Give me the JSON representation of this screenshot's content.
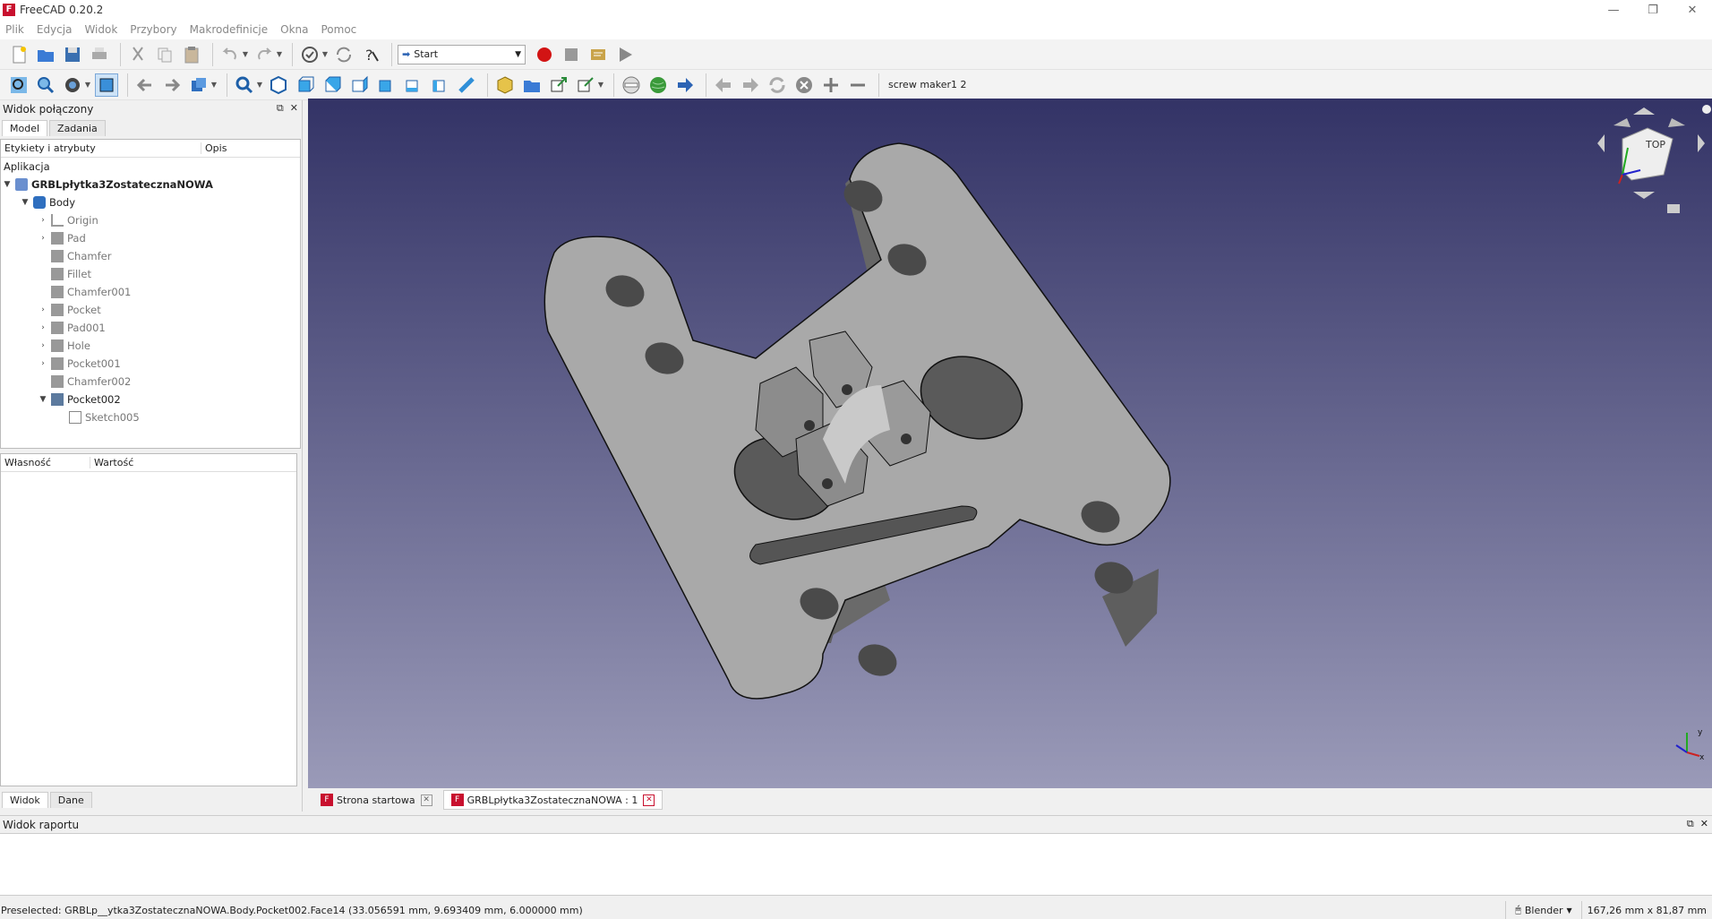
{
  "app": {
    "title": "FreeCAD 0.20.2"
  },
  "menu": [
    "Plik",
    "Edycja",
    "Widok",
    "Przybory",
    "Makrodefinicje",
    "Okna",
    "Pomoc"
  ],
  "toolbar": {
    "workbench": "Start",
    "macro_label": "screw maker1 2"
  },
  "combo_view": {
    "title": "Widok połączony",
    "tabs": [
      "Model",
      "Zadania"
    ],
    "col_labels": "Etykiety i atrybuty",
    "col_desc": "Opis",
    "app_label": "Aplikacja",
    "document": "GRBLpłytka3ZostatecznaNOWA",
    "body": "Body",
    "features": [
      "Origin",
      "Pad",
      "Chamfer",
      "Fillet",
      "Chamfer001",
      "Pocket",
      "Pad001",
      "Hole",
      "Pocket001",
      "Chamfer002",
      "Pocket002"
    ],
    "sketch": "Sketch005"
  },
  "property_view": {
    "col_property": "Własność",
    "col_value": "Wartość",
    "tabs": [
      "Widok",
      "Dane"
    ]
  },
  "doc_tabs": [
    "Strona startowa",
    "GRBLpłytka3ZostatecznaNOWA : 1"
  ],
  "report_view": {
    "title": "Widok raportu"
  },
  "status": {
    "message": "Preselected: GRBLp__ytka3ZostatecznaNOWA.Body.Pocket002.Face14 (33.056591 mm, 9.693409 mm, 6.000000 mm)",
    "navigation": "Blender",
    "dimensions": "167,26 mm x 81,87 mm"
  },
  "colors": {
    "viewport_top": "#333366",
    "viewport_bottom": "#9a9ab8",
    "part": "#a9a9a9",
    "freecad_red": "#c8102e"
  }
}
